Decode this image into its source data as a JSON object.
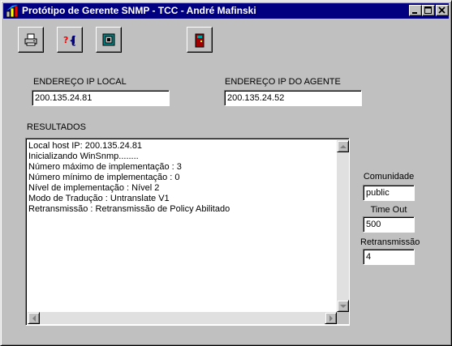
{
  "window": {
    "title": "Protótipo de Gerente SNMP - TCC - André Mafinski"
  },
  "toolbar": {
    "buttons": [
      {
        "icon": "printer-icon"
      },
      {
        "icon": "help-icon"
      },
      {
        "icon": "stop-icon"
      },
      {
        "icon": "exit-door-icon"
      }
    ]
  },
  "local_ip": {
    "label": "ENDEREÇO IP LOCAL",
    "value": "200.135.24.81"
  },
  "agent_ip": {
    "label": "ENDEREÇO IP DO AGENTE",
    "value": "200.135.24.52"
  },
  "results": {
    "label": "RESULTADOS",
    "lines": [
      "Local host IP: 200.135.24.81",
      "Inicializando WinSnmp........",
      "Número máximo de implementação : 3",
      "Número mínimo de implementação : 0",
      "Nível de implementação : Nível 2",
      "Modo de Tradução : Untranslate V1",
      "Retransmissão : Retransmissão de Policy Abilitado"
    ]
  },
  "community": {
    "label": "Comunidade",
    "value": "public"
  },
  "timeout": {
    "label": "Time Out",
    "value": "500"
  },
  "retransmission": {
    "label": "Retransmissão",
    "value": "4"
  },
  "colors": {
    "titlebar": "#000080",
    "face": "#c0c0c0",
    "exit_icon": "#a00000",
    "stop_icon": "#008080"
  }
}
